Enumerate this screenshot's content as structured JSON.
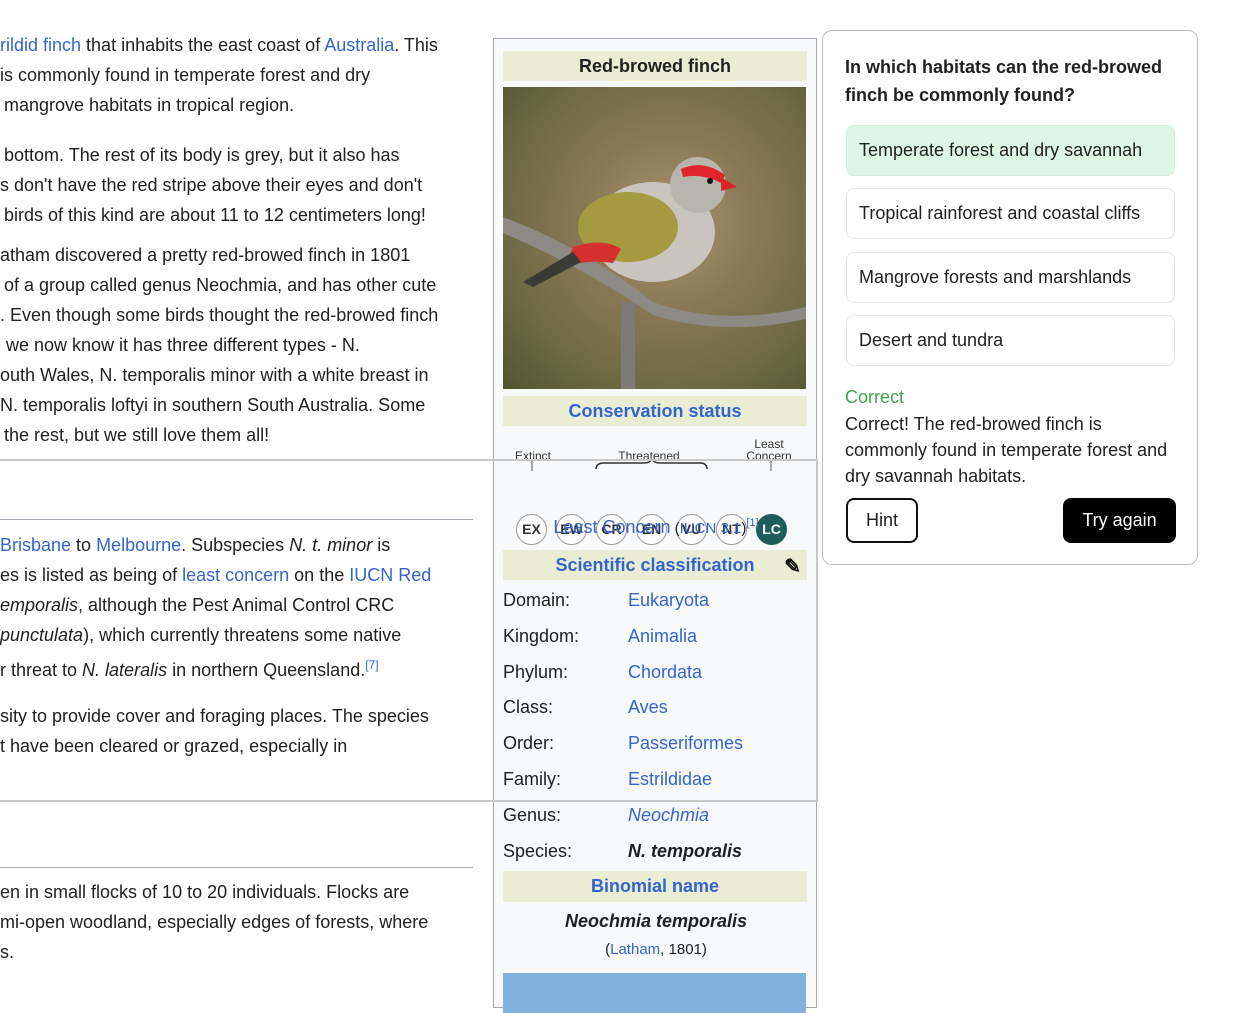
{
  "article": {
    "p1": [
      [
        "rildid finch",
        "link"
      ],
      [
        " that inhabits the east coast of ",
        "t"
      ],
      [
        "Australia",
        "link"
      ],
      [
        ". This",
        "t"
      ]
    ],
    "lines1": [
      "is commonly found in temperate forest and dry",
      "mangrove habitats in tropical region."
    ],
    "lines2": [
      "bottom. The rest of its body is grey, but it also has",
      "s don't have the red stripe above their eyes and don't",
      "birds of this kind are about 11 to 12 centimeters long!"
    ],
    "lines3": [
      "atham discovered a pretty red-browed finch in 1801",
      "of a group called genus Neochmia, and has other cute",
      ". Even though some birds thought the red-browed finch",
      "we now know it has three different types - N.",
      "outh Wales, N. temporalis minor with a white breast in",
      "N. temporalis loftyi in southern South Australia. Some",
      "the rest, but we still love them all!"
    ],
    "dist": [
      [
        [
          "Brisbane",
          "link"
        ],
        [
          " to ",
          "t"
        ],
        [
          "Melbourne",
          "link"
        ],
        [
          ". Subspecies ",
          "t"
        ],
        [
          "N. t. minor",
          "i"
        ],
        [
          " is",
          "t"
        ]
      ],
      [
        [
          "es is listed as being of ",
          "t"
        ],
        [
          "least concern",
          "link"
        ],
        [
          " on the ",
          "t"
        ],
        [
          "IUCN Red",
          "link"
        ]
      ],
      [
        [
          "emporalis",
          "i"
        ],
        [
          ", although the Pest Animal Control CRC",
          "t"
        ]
      ],
      [
        [
          "punctulata",
          "i"
        ],
        [
          "), which currently threatens some native",
          "t"
        ]
      ],
      [
        [
          "r threat to ",
          "t"
        ],
        [
          "N. lateralis",
          "i"
        ],
        [
          " in northern Queensland.",
          "t"
        ],
        [
          "[7]",
          "sup"
        ]
      ]
    ],
    "lines4": [
      "sity to provide cover and foraging places. The species",
      "t have been cleared or grazed, especially in"
    ],
    "lines5": [
      "en in small flocks of 10 to 20 individuals. Flocks are",
      "mi-open woodland, especially edges of forests, where",
      "s."
    ]
  },
  "infobox": {
    "title": "Red-browed finch",
    "conservation_header": "Conservation status",
    "scale_labels": {
      "extinct": "Extinct",
      "threatened": "Threatened",
      "least1": "Least",
      "least2": "Concern"
    },
    "badges": [
      "EX",
      "EW",
      "CR",
      "EN",
      "VU",
      "NT",
      "LC"
    ],
    "active_badge": "LC",
    "active_color": "#1d5d5a",
    "status": "Least Concern",
    "status_src_open": " (",
    "status_src": "IUCN 3.1",
    "status_src_close": ")",
    "status_ref": "[1]",
    "classification_header": "Scientific classification",
    "classification": [
      {
        "k": "Domain:",
        "v": "Eukaryota",
        "style": "link"
      },
      {
        "k": "Kingdom:",
        "v": "Animalia",
        "style": "link"
      },
      {
        "k": "Phylum:",
        "v": "Chordata",
        "style": "link"
      },
      {
        "k": "Class:",
        "v": "Aves",
        "style": "link"
      },
      {
        "k": "Order:",
        "v": "Passeriformes",
        "style": "link"
      },
      {
        "k": "Family:",
        "v": "Estrildidae",
        "style": "link"
      },
      {
        "k": "Genus:",
        "v": "Neochmia",
        "style": "link-italic"
      },
      {
        "k": "Species:",
        "v": "N. temporalis",
        "style": "bold-italic"
      }
    ],
    "binomial_header": "Binomial name",
    "binomial": "Neochmia temporalis",
    "authority_open": "(",
    "authority": "Latham",
    "authority_rest": ", 1801)"
  },
  "quiz": {
    "question": "In which habitats can the red-browed finch be commonly found?",
    "options": [
      "Temperate forest and dry savannah",
      "Tropical rainforest and coastal cliffs",
      "Mangrove forests and marshlands",
      "Desert and tundra"
    ],
    "selected": 0,
    "result": "Correct",
    "result_color": "#3fa34d",
    "explanation": "Correct! The red-browed finch is commonly found in temperate forest and dry savannah habitats.",
    "hint_label": "Hint",
    "retry_label": "Try again"
  }
}
